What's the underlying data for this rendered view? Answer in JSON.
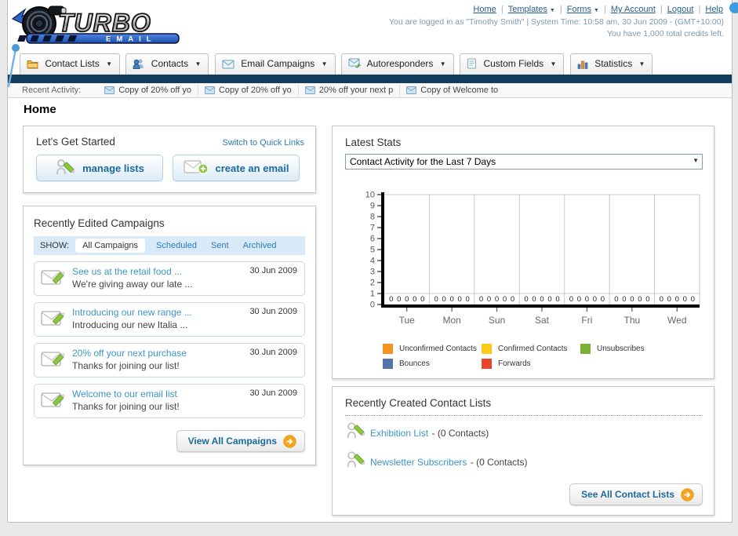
{
  "brand": {
    "title": "TURBO",
    "subtitle": "EMAIL"
  },
  "utility_nav": {
    "links": [
      {
        "label": "Home",
        "dropdown": false
      },
      {
        "label": "Templates",
        "dropdown": true
      },
      {
        "label": "Forms",
        "dropdown": true
      },
      {
        "label": "My Account",
        "dropdown": false
      },
      {
        "label": "Logout",
        "dropdown": false
      },
      {
        "label": "Help",
        "dropdown": false
      }
    ],
    "login_info": "You are logged in as \"Timothy Smith\" | System Time: 10:58 am, 30 Jun 2009 - (GMT+10:00)",
    "credits_info": "You have 1,000 total credits left."
  },
  "main_nav": [
    {
      "label": "Contact Lists"
    },
    {
      "label": "Contacts"
    },
    {
      "label": "Email Campaigns"
    },
    {
      "label": "Autoresponders"
    },
    {
      "label": "Custom Fields"
    },
    {
      "label": "Statistics"
    }
  ],
  "recent_activity": {
    "label": "Recent Activity:",
    "items": [
      {
        "title": "Copy of 20% off yo"
      },
      {
        "title": "Copy of 20% off yo"
      },
      {
        "title": "20% off your next p"
      },
      {
        "title": "Copy of Welcome to"
      }
    ]
  },
  "page_title": "Home",
  "get_started": {
    "title": "Let's Get Started",
    "switch_link": "Switch to Quick Links",
    "buttons": [
      {
        "label": "manage lists"
      },
      {
        "label": "create an email"
      }
    ]
  },
  "campaigns": {
    "title": "Recently Edited Campaigns",
    "show_label": "SHOW:",
    "filters": [
      {
        "label": "All Campaigns",
        "selected": true
      },
      {
        "label": "Scheduled",
        "selected": false
      },
      {
        "label": "Sent",
        "selected": false
      },
      {
        "label": "Archived",
        "selected": false
      }
    ],
    "items": [
      {
        "title": "See us at the retail food ...",
        "subtitle": "We're giving away our late ...",
        "date": "30 Jun 2009"
      },
      {
        "title": "Introducing our new range ...",
        "subtitle": "Introducing our new Italia ...",
        "date": "30 Jun 2009"
      },
      {
        "title": "20% off your next purchase",
        "subtitle": "Thanks for joining our list!",
        "date": "30 Jun 2009"
      },
      {
        "title": "Welcome to our email list",
        "subtitle": "Thanks for joining our list!",
        "date": "30 Jun 2009"
      }
    ],
    "view_all_label": "View All Campaigns"
  },
  "stats": {
    "title": "Latest Stats",
    "selected_option": "Contact Activity for the Last 7 Days"
  },
  "chart_data": {
    "type": "bar",
    "categories": [
      "Tue",
      "Mon",
      "Sun",
      "Sat",
      "Fri",
      "Thu",
      "Wed"
    ],
    "series": [
      {
        "name": "Unconfirmed Contacts",
        "color": "#f6921e",
        "values": [
          0,
          0,
          0,
          0,
          0,
          0,
          0
        ]
      },
      {
        "name": "Confirmed Contacts",
        "color": "#fdc818",
        "values": [
          0,
          0,
          0,
          0,
          0,
          0,
          0
        ]
      },
      {
        "name": "Unsubscribes",
        "color": "#7ab033",
        "values": [
          0,
          0,
          0,
          0,
          0,
          0,
          0
        ]
      },
      {
        "name": "Bounces",
        "color": "#5575a8",
        "values": [
          0,
          0,
          0,
          0,
          0,
          0,
          0
        ]
      },
      {
        "name": "Forwards",
        "color": "#e8472b",
        "values": [
          0,
          0,
          0,
          0,
          0,
          0,
          0
        ]
      }
    ],
    "ylim": [
      0,
      10
    ],
    "ytick_step": 1,
    "grid": true,
    "legend_position": "bottom",
    "show_zero_labels": true,
    "title": "",
    "xlabel": "",
    "ylabel": ""
  },
  "contact_lists": {
    "title": "Recently Created Contact Lists",
    "items": [
      {
        "name": "Exhibition List",
        "detail": "- (0 Contacts)"
      },
      {
        "name": "Newsletter Subscribers",
        "detail": "- (0 Contacts)"
      }
    ],
    "see_all_label": "See All Contact Lists"
  }
}
